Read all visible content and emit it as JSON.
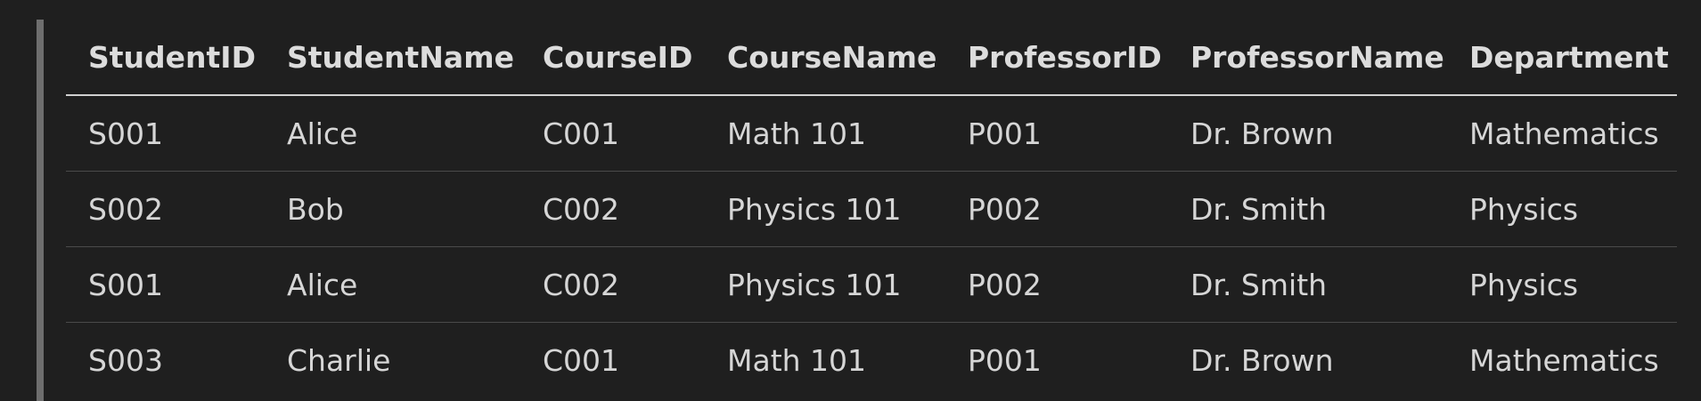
{
  "table": {
    "headers": [
      "StudentID",
      "StudentName",
      "CourseID",
      "CourseName",
      "ProfessorID",
      "ProfessorName",
      "Department"
    ],
    "rows": [
      [
        "S001",
        "Alice",
        "C001",
        "Math 101",
        "P001",
        "Dr. Brown",
        "Mathematics"
      ],
      [
        "S002",
        "Bob",
        "C002",
        "Physics 101",
        "P002",
        "Dr. Smith",
        "Physics"
      ],
      [
        "S001",
        "Alice",
        "C002",
        "Physics 101",
        "P002",
        "Dr. Smith",
        "Physics"
      ],
      [
        "S003",
        "Charlie",
        "C001",
        "Math 101",
        "P001",
        "Dr. Brown",
        "Mathematics"
      ]
    ]
  }
}
